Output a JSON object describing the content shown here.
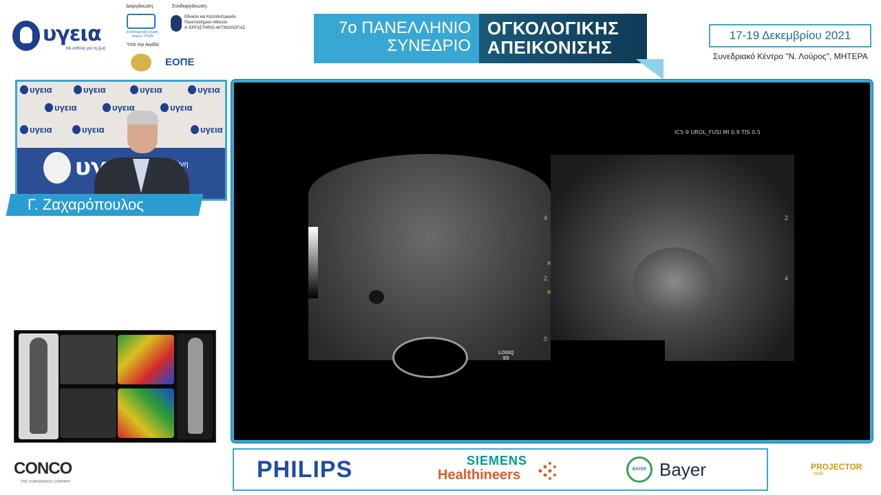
{
  "header": {
    "host_logo_text": "υγεια",
    "host_logo_tagline": "Με ευθύνη για τη ζωή",
    "organizer_label": "Διοργάνωση:",
    "organizer_name": "Επιστημονική ένωση ιατρών ΥΓΕΙΑ",
    "coorganizer_label": "Συνδιοργάνωση:",
    "coorganizer_name_1": "Εθνικόν και Καποδιστριακόν",
    "coorganizer_name_2": "Πανεπιστήμιον Αθηνών",
    "coorganizer_name_3": "Α' ΕΡΓΑΣΤΗΡΙΟ ΑΚΤΙΝΟΛΟΓΙΑΣ",
    "auspices_label": "Υπό την Αιγίδα:",
    "auspices_logo": "ΕΟΠΕ"
  },
  "banner": {
    "left_line1": "7ο ΠΑΝΕΛΛΗΝΙΟ",
    "left_line2": "ΣΥΝΕΔΡΙΟ",
    "right_line1": "ΟΓΚΟΛΟΓΙΚΗΣ",
    "right_line2": "ΑΠΕΙΚΟΝΙΣΗΣ"
  },
  "event": {
    "dates": "17-19 Δεκεμβρίου 2021",
    "venue": "Συνεδριακό Κέντρο \"Ν. Λούρος\", ΜΗΤΕΡΑ"
  },
  "speaker": {
    "name": "Γ. Ζαχαρόπουλος",
    "wall_logo_text": "υγεια",
    "backdrop_text": "υγεια",
    "backdrop_tagline": "ε ευθύνη"
  },
  "slide": {
    "ultrasound_meta": "IC5-9  UROL_FUSI  MI 0.9  TIS 0.5",
    "device_line1": "LOGIQ",
    "device_line2": "E9",
    "depth_ticks": [
      "4",
      "2",
      "0"
    ],
    "mri_ticks": [
      "2",
      "4"
    ]
  },
  "sponsors": {
    "philips": "PHILIPS",
    "siemens": "SIEMENS",
    "healthineers": "Healthineers",
    "bayer": "Bayer",
    "bayer_circle": "BAYER"
  },
  "footer": {
    "conco": "CONCO",
    "conco_sub": "THE CONFERENCE COMPANY",
    "projector": "PROJECTOR",
    "projector_sub": "Web"
  },
  "colors": {
    "accent": "#39a7d4",
    "navy": "#1d3f8c",
    "banner_dark": "#0f3a55"
  }
}
